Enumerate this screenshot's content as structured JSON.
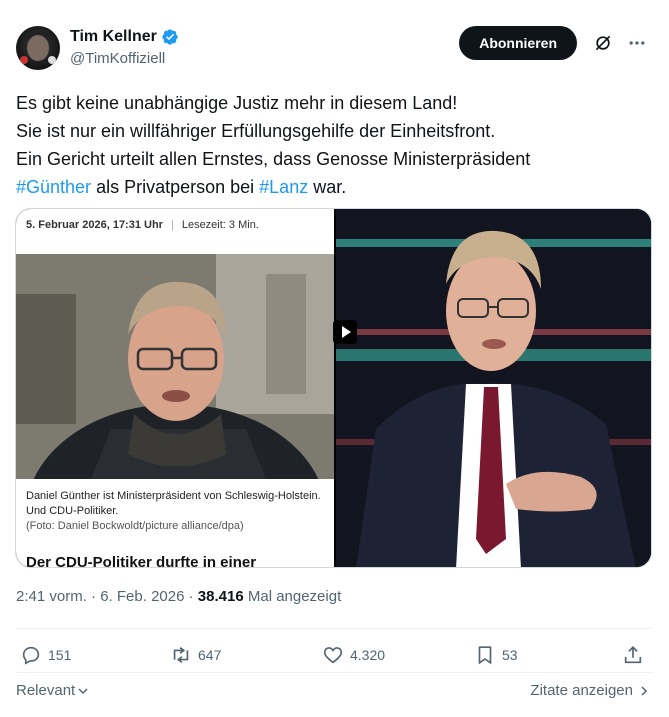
{
  "author": {
    "display_name": "Tim Kellner",
    "handle": "@TimKoffiziell",
    "verified": true,
    "verified_color": "#1d9bf0"
  },
  "header": {
    "follow_label": "Abonnieren",
    "icons": [
      "grok-icon",
      "more-icon"
    ]
  },
  "tweet": {
    "line1": "Es gibt keine unabhängige Justiz mehr in diesem Land!",
    "line2": "Sie ist nur ein willfähriger Erfüllungsgehilfe der Einheitsfront.",
    "line3": "Ein Gericht urteilt allen Ernstes, dass Genosse Ministerpräsident",
    "hashtag1": "#Günther",
    "mid": " als Privatperson bei ",
    "hashtag2": "#Lanz",
    "end": " war.",
    "hashtag_color": "#1d9bf0"
  },
  "media": {
    "article": {
      "date": "5. Februar 2026, 17:31 Uhr",
      "separator": "|",
      "reading_time": "Lesezeit: 3 Min.",
      "caption": "Daniel Günther ist Ministerpräsident von Schleswig-Holstein. Und CDU-Politiker.",
      "credit": "(Foto: Daniel Bockwoldt/picture alliance/dpa)",
      "headline": "Der CDU-Politiker durfte in einer"
    },
    "video": {
      "play_icon": "play-icon"
    }
  },
  "meta": {
    "time": "2:41 vorm.",
    "dot1": " · ",
    "date": "6. Feb. 2026",
    "dot2": " · ",
    "views": "38.416",
    "views_label": " Mal angezeigt"
  },
  "actions": {
    "replies": "151",
    "reposts": "647",
    "likes": "4.320",
    "bookmarks": "53",
    "icons": [
      "reply-icon",
      "repost-icon",
      "like-icon",
      "bookmark-icon",
      "share-icon"
    ]
  },
  "footer": {
    "relevant_label": "Relevant",
    "quotes_label": "Zitate anzeigen"
  }
}
